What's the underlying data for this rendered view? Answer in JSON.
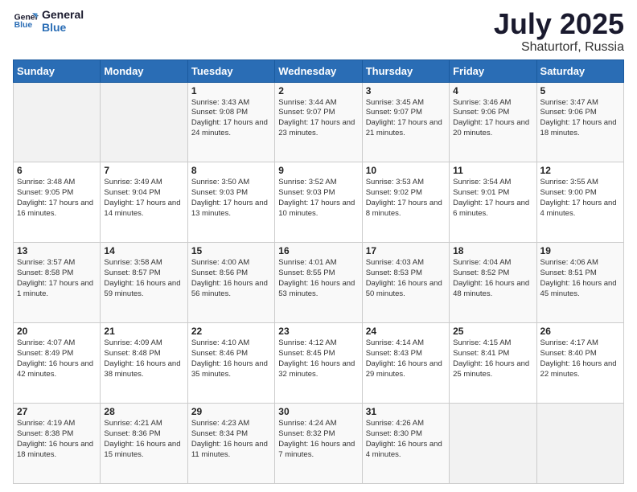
{
  "header": {
    "logo_line1": "General",
    "logo_line2": "Blue",
    "month": "July 2025",
    "location": "Shaturtorf, Russia"
  },
  "days_of_week": [
    "Sunday",
    "Monday",
    "Tuesday",
    "Wednesday",
    "Thursday",
    "Friday",
    "Saturday"
  ],
  "weeks": [
    [
      {
        "day": "",
        "info": ""
      },
      {
        "day": "",
        "info": ""
      },
      {
        "day": "1",
        "info": "Sunrise: 3:43 AM\nSunset: 9:08 PM\nDaylight: 17 hours and 24 minutes."
      },
      {
        "day": "2",
        "info": "Sunrise: 3:44 AM\nSunset: 9:07 PM\nDaylight: 17 hours and 23 minutes."
      },
      {
        "day": "3",
        "info": "Sunrise: 3:45 AM\nSunset: 9:07 PM\nDaylight: 17 hours and 21 minutes."
      },
      {
        "day": "4",
        "info": "Sunrise: 3:46 AM\nSunset: 9:06 PM\nDaylight: 17 hours and 20 minutes."
      },
      {
        "day": "5",
        "info": "Sunrise: 3:47 AM\nSunset: 9:06 PM\nDaylight: 17 hours and 18 minutes."
      }
    ],
    [
      {
        "day": "6",
        "info": "Sunrise: 3:48 AM\nSunset: 9:05 PM\nDaylight: 17 hours and 16 minutes."
      },
      {
        "day": "7",
        "info": "Sunrise: 3:49 AM\nSunset: 9:04 PM\nDaylight: 17 hours and 14 minutes."
      },
      {
        "day": "8",
        "info": "Sunrise: 3:50 AM\nSunset: 9:03 PM\nDaylight: 17 hours and 13 minutes."
      },
      {
        "day": "9",
        "info": "Sunrise: 3:52 AM\nSunset: 9:03 PM\nDaylight: 17 hours and 10 minutes."
      },
      {
        "day": "10",
        "info": "Sunrise: 3:53 AM\nSunset: 9:02 PM\nDaylight: 17 hours and 8 minutes."
      },
      {
        "day": "11",
        "info": "Sunrise: 3:54 AM\nSunset: 9:01 PM\nDaylight: 17 hours and 6 minutes."
      },
      {
        "day": "12",
        "info": "Sunrise: 3:55 AM\nSunset: 9:00 PM\nDaylight: 17 hours and 4 minutes."
      }
    ],
    [
      {
        "day": "13",
        "info": "Sunrise: 3:57 AM\nSunset: 8:58 PM\nDaylight: 17 hours and 1 minute."
      },
      {
        "day": "14",
        "info": "Sunrise: 3:58 AM\nSunset: 8:57 PM\nDaylight: 16 hours and 59 minutes."
      },
      {
        "day": "15",
        "info": "Sunrise: 4:00 AM\nSunset: 8:56 PM\nDaylight: 16 hours and 56 minutes."
      },
      {
        "day": "16",
        "info": "Sunrise: 4:01 AM\nSunset: 8:55 PM\nDaylight: 16 hours and 53 minutes."
      },
      {
        "day": "17",
        "info": "Sunrise: 4:03 AM\nSunset: 8:53 PM\nDaylight: 16 hours and 50 minutes."
      },
      {
        "day": "18",
        "info": "Sunrise: 4:04 AM\nSunset: 8:52 PM\nDaylight: 16 hours and 48 minutes."
      },
      {
        "day": "19",
        "info": "Sunrise: 4:06 AM\nSunset: 8:51 PM\nDaylight: 16 hours and 45 minutes."
      }
    ],
    [
      {
        "day": "20",
        "info": "Sunrise: 4:07 AM\nSunset: 8:49 PM\nDaylight: 16 hours and 42 minutes."
      },
      {
        "day": "21",
        "info": "Sunrise: 4:09 AM\nSunset: 8:48 PM\nDaylight: 16 hours and 38 minutes."
      },
      {
        "day": "22",
        "info": "Sunrise: 4:10 AM\nSunset: 8:46 PM\nDaylight: 16 hours and 35 minutes."
      },
      {
        "day": "23",
        "info": "Sunrise: 4:12 AM\nSunset: 8:45 PM\nDaylight: 16 hours and 32 minutes."
      },
      {
        "day": "24",
        "info": "Sunrise: 4:14 AM\nSunset: 8:43 PM\nDaylight: 16 hours and 29 minutes."
      },
      {
        "day": "25",
        "info": "Sunrise: 4:15 AM\nSunset: 8:41 PM\nDaylight: 16 hours and 25 minutes."
      },
      {
        "day": "26",
        "info": "Sunrise: 4:17 AM\nSunset: 8:40 PM\nDaylight: 16 hours and 22 minutes."
      }
    ],
    [
      {
        "day": "27",
        "info": "Sunrise: 4:19 AM\nSunset: 8:38 PM\nDaylight: 16 hours and 18 minutes."
      },
      {
        "day": "28",
        "info": "Sunrise: 4:21 AM\nSunset: 8:36 PM\nDaylight: 16 hours and 15 minutes."
      },
      {
        "day": "29",
        "info": "Sunrise: 4:23 AM\nSunset: 8:34 PM\nDaylight: 16 hours and 11 minutes."
      },
      {
        "day": "30",
        "info": "Sunrise: 4:24 AM\nSunset: 8:32 PM\nDaylight: 16 hours and 7 minutes."
      },
      {
        "day": "31",
        "info": "Sunrise: 4:26 AM\nSunset: 8:30 PM\nDaylight: 16 hours and 4 minutes."
      },
      {
        "day": "",
        "info": ""
      },
      {
        "day": "",
        "info": ""
      }
    ]
  ]
}
